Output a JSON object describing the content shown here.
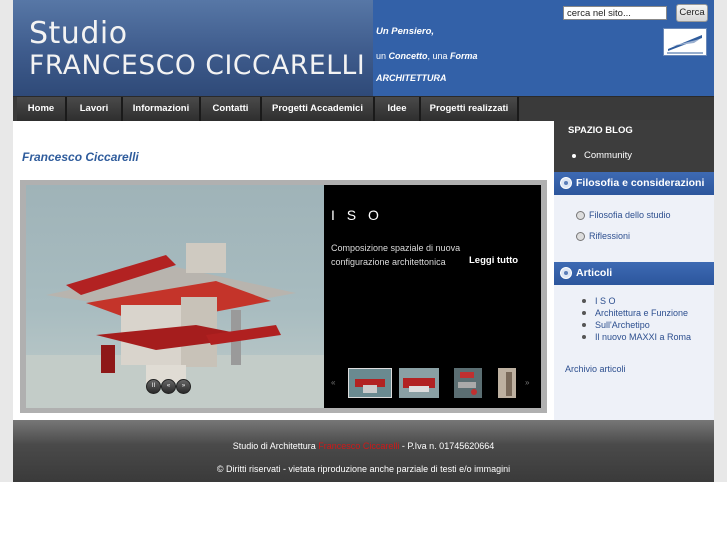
{
  "header": {
    "logo_line1": "Studio",
    "logo_line2": "FRANCESCO CICCARELLI",
    "tagline1": "Un Pensiero,",
    "tagline2_a": "un ",
    "tagline2_b": "Concetto",
    "tagline2_c": ", una ",
    "tagline2_d": "Forma",
    "tagline3": "ARCHITETTURA",
    "search_value": "cerca nel sito...",
    "search_button": "Cerca"
  },
  "nav": [
    {
      "label": "Home"
    },
    {
      "label": "Lavori"
    },
    {
      "label": "Informazioni"
    },
    {
      "label": "Contatti"
    },
    {
      "label": "Progetti Accademici"
    },
    {
      "label": "Idee"
    },
    {
      "label": "Progetti realizzati"
    }
  ],
  "main": {
    "title": "Francesco Ciccarelli",
    "slide": {
      "title": "I S O",
      "description": "Composizione spaziale di nuova configurazione architettonica",
      "read_more": "Leggi tutto"
    },
    "controls": {
      "pause": "II",
      "prev": "«",
      "next": "»"
    },
    "thumb_arrows": {
      "left": "«",
      "right": "»"
    }
  },
  "sidebar": {
    "blog_title": "SPAZIO BLOG",
    "blog_items": [
      "Community"
    ],
    "sections": [
      {
        "title": "Filosofia e considerazioni",
        "items": [
          "Filosofia dello studio",
          "Riflessioni"
        ]
      },
      {
        "title": "Articoli",
        "items": [
          "I S O",
          "Architettura e Funzione",
          "Sull'Archetipo",
          "Il nuovo MAXXI a Roma"
        ]
      }
    ],
    "archive_link": "Archivio articoli"
  },
  "footer": {
    "line1_a": "Studio di Architettura ",
    "line1_name": "Francesco Ciccarelli",
    "line1_b": " - P.Iva n. 01745620664",
    "line2": "© Diritti riservati - vietata riproduzione anche parziale di testi e/o immagini"
  },
  "colors": {
    "header_blue": "#3361a8",
    "section_blue": "#2c569d",
    "link_blue": "#2d4f8f",
    "footer_name_red": "#d01818",
    "nav_dark": "#3a3a3a"
  }
}
